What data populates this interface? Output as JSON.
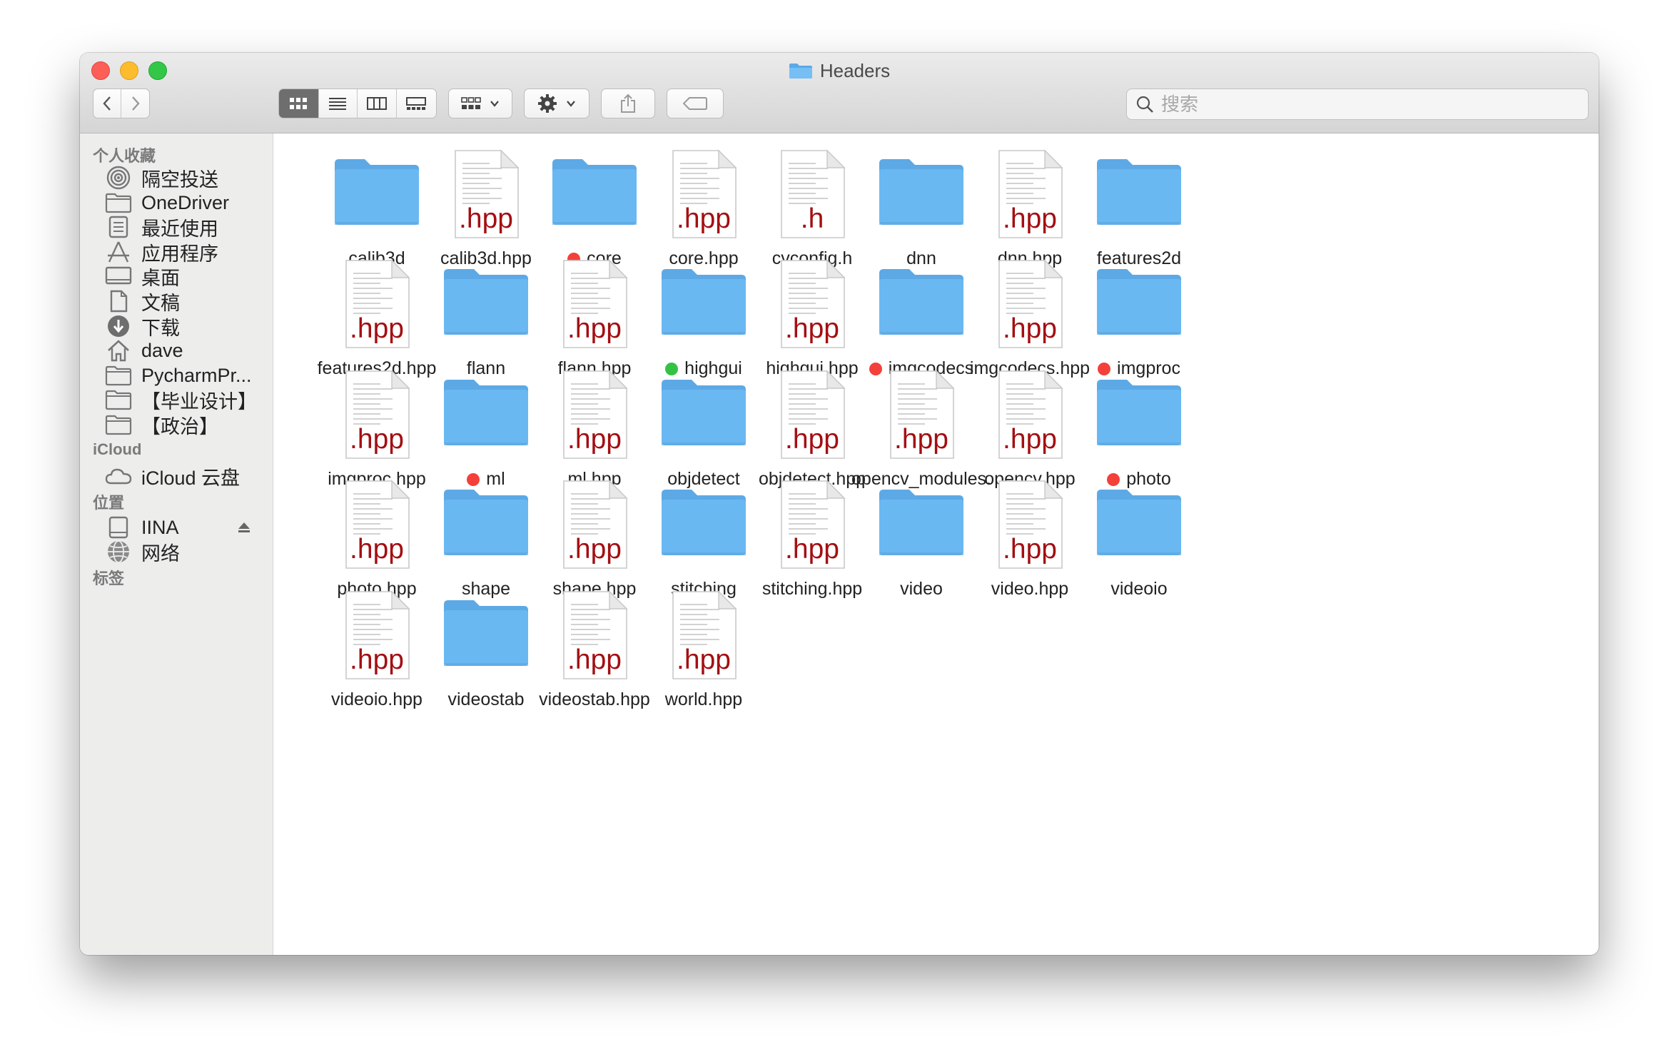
{
  "window": {
    "title": "Headers"
  },
  "toolbar": {
    "view_modes": [
      "icon-view",
      "list-view",
      "column-view",
      "gallery-view"
    ],
    "active_view": "icon-view"
  },
  "search": {
    "placeholder": "搜索"
  },
  "sidebar": {
    "sections": [
      {
        "title": "个人收藏",
        "items": [
          {
            "label": "隔空投送",
            "icon": "airdrop-icon"
          },
          {
            "label": "OneDriver",
            "icon": "folder-icon"
          },
          {
            "label": "最近使用",
            "icon": "recents-icon"
          },
          {
            "label": "应用程序",
            "icon": "applications-icon"
          },
          {
            "label": "桌面",
            "icon": "desktop-icon"
          },
          {
            "label": "文稿",
            "icon": "documents-icon"
          },
          {
            "label": "下载",
            "icon": "downloads-icon"
          },
          {
            "label": "dave",
            "icon": "home-icon"
          },
          {
            "label": "PycharmPr...",
            "icon": "folder-icon"
          },
          {
            "label": "【毕业设计】",
            "icon": "folder-icon"
          },
          {
            "label": "【政治】",
            "icon": "folder-icon"
          }
        ]
      },
      {
        "title": "iCloud",
        "items": [
          {
            "label": "iCloud 云盘",
            "icon": "cloud-icon"
          }
        ]
      },
      {
        "title": "位置",
        "items": [
          {
            "label": "IINA",
            "icon": "disk-icon"
          },
          {
            "label": "网络",
            "icon": "network-icon"
          }
        ]
      },
      {
        "title": "标签",
        "items": []
      }
    ]
  },
  "colors": {
    "red_tag": "#f3403a",
    "green_tag": "#34c245",
    "folder": "#6ab8f2",
    "ext_text": "#a30f12"
  },
  "files": [
    {
      "name": "calib3d",
      "kind": "folder",
      "tag": ""
    },
    {
      "name": "calib3d.hpp",
      "kind": "doc",
      "ext": ".hpp",
      "tag": ""
    },
    {
      "name": "core",
      "kind": "folder",
      "tag": "red"
    },
    {
      "name": "core.hpp",
      "kind": "doc",
      "ext": ".hpp",
      "tag": ""
    },
    {
      "name": "cvconfig.h",
      "kind": "doc",
      "ext": ".h",
      "tag": ""
    },
    {
      "name": "dnn",
      "kind": "folder",
      "tag": ""
    },
    {
      "name": "dnn.hpp",
      "kind": "doc",
      "ext": ".hpp",
      "tag": ""
    },
    {
      "name": "features2d",
      "kind": "folder",
      "tag": ""
    },
    {
      "name": "features2d.hpp",
      "kind": "doc",
      "ext": ".hpp",
      "tag": ""
    },
    {
      "name": "flann",
      "kind": "folder",
      "tag": ""
    },
    {
      "name": "flann.hpp",
      "kind": "doc",
      "ext": ".hpp",
      "tag": ""
    },
    {
      "name": "highgui",
      "kind": "folder",
      "tag": "green"
    },
    {
      "name": "highgui.hpp",
      "kind": "doc",
      "ext": ".hpp",
      "tag": ""
    },
    {
      "name": "imgcodecs",
      "kind": "folder",
      "tag": "red"
    },
    {
      "name": "imgcodecs.hpp",
      "kind": "doc",
      "ext": ".hpp",
      "tag": ""
    },
    {
      "name": "imgproc",
      "kind": "folder",
      "tag": "red"
    },
    {
      "name": "imgproc.hpp",
      "kind": "doc",
      "ext": ".hpp",
      "tag": ""
    },
    {
      "name": "ml",
      "kind": "folder",
      "tag": "red"
    },
    {
      "name": "ml.hpp",
      "kind": "doc",
      "ext": ".hpp",
      "tag": ""
    },
    {
      "name": "objdetect",
      "kind": "folder",
      "tag": ""
    },
    {
      "name": "objdetect.hpp",
      "kind": "doc",
      "ext": ".hpp",
      "tag": ""
    },
    {
      "name": "opencv_modules.\nhpp",
      "kind": "doc",
      "ext": ".hpp",
      "tag": ""
    },
    {
      "name": "opencv.hpp",
      "kind": "doc",
      "ext": ".hpp",
      "tag": ""
    },
    {
      "name": "photo",
      "kind": "folder",
      "tag": "red"
    },
    {
      "name": "photo.hpp",
      "kind": "doc",
      "ext": ".hpp",
      "tag": ""
    },
    {
      "name": "shape",
      "kind": "folder",
      "tag": ""
    },
    {
      "name": "shape.hpp",
      "kind": "doc",
      "ext": ".hpp",
      "tag": ""
    },
    {
      "name": "stitching",
      "kind": "folder",
      "tag": ""
    },
    {
      "name": "stitching.hpp",
      "kind": "doc",
      "ext": ".hpp",
      "tag": ""
    },
    {
      "name": "video",
      "kind": "folder",
      "tag": ""
    },
    {
      "name": "video.hpp",
      "kind": "doc",
      "ext": ".hpp",
      "tag": ""
    },
    {
      "name": "videoio",
      "kind": "folder",
      "tag": ""
    },
    {
      "name": "videoio.hpp",
      "kind": "doc",
      "ext": ".hpp",
      "tag": ""
    },
    {
      "name": "videostab",
      "kind": "folder",
      "tag": ""
    },
    {
      "name": "videostab.hpp",
      "kind": "doc",
      "ext": ".hpp",
      "tag": ""
    },
    {
      "name": "world.hpp",
      "kind": "doc",
      "ext": ".hpp",
      "tag": ""
    }
  ]
}
